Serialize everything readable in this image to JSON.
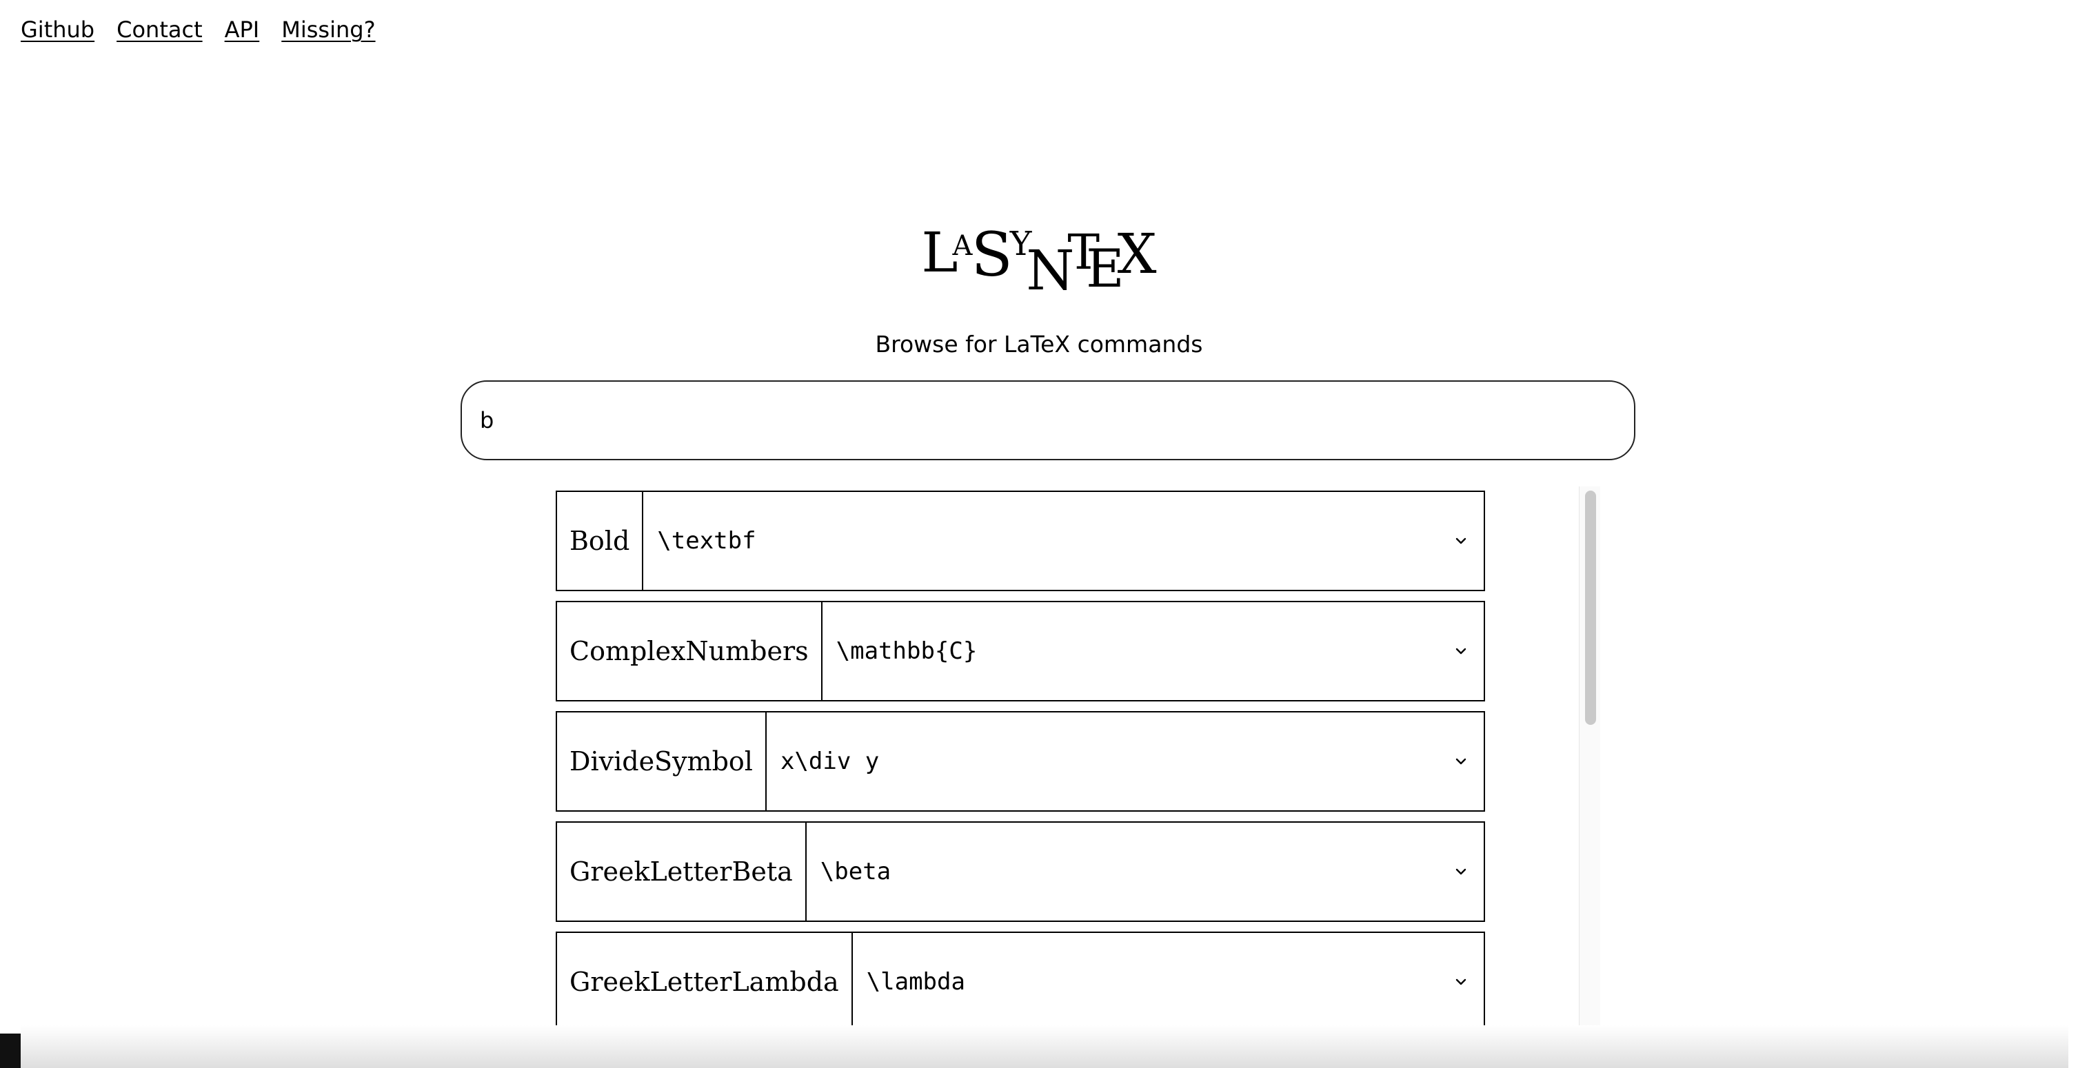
{
  "nav": {
    "github": "Github",
    "contact": "Contact",
    "api": "API",
    "missing": "Missing?"
  },
  "logo": {
    "parts": [
      "L",
      "A",
      "S",
      "Y",
      "N",
      "T",
      "E",
      "X"
    ]
  },
  "subtitle": "Browse for LaTeX commands",
  "search": {
    "value": "b",
    "placeholder": ""
  },
  "results": [
    {
      "name": "Bold",
      "command": "\\textbf"
    },
    {
      "name": "ComplexNumbers",
      "command": "\\mathbb{C}"
    },
    {
      "name": "DivideSymbol",
      "command": "x\\div y"
    },
    {
      "name": "GreekLetterBeta",
      "command": "\\beta"
    },
    {
      "name": "GreekLetterLambda",
      "command": "\\lambda"
    }
  ],
  "icons": {
    "row_toggle": "chevron-down-icon"
  }
}
